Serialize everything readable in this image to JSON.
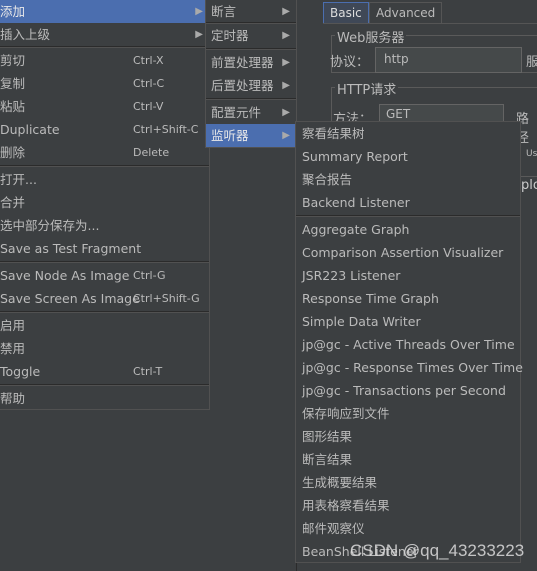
{
  "background": {
    "tabs": [
      "Basic",
      "Advanced"
    ],
    "web_server_group": "Web服务器",
    "protocol_label": "协议：",
    "protocol_value": "http",
    "server_label_partial": "服",
    "http_request_group": "HTTP请求",
    "method_label": "方法：",
    "method_value": "GET",
    "path_label_partial": "路径",
    "use_partial": "Us",
    "plo_partial": "plo"
  },
  "main_menu": {
    "items": [
      {
        "label": "添加",
        "submenu": true,
        "selected": true
      },
      {
        "label": "插入上级",
        "submenu": true
      },
      {
        "label": "剪切",
        "shortcut": "Ctrl-X"
      },
      {
        "label": "复制",
        "shortcut": "Ctrl-C"
      },
      {
        "label": "粘贴",
        "shortcut": "Ctrl-V"
      },
      {
        "label": "Duplicate",
        "shortcut": "Ctrl+Shift-C"
      },
      {
        "label": "删除",
        "shortcut": "Delete"
      },
      {
        "label": "打开..."
      },
      {
        "label": "合并"
      },
      {
        "label": "选中部分保存为..."
      },
      {
        "label": "Save as Test Fragment"
      },
      {
        "label": "Save Node As Image",
        "shortcut": "Ctrl-G"
      },
      {
        "label": "Save Screen As Image",
        "shortcut": "Ctrl+Shift-G"
      },
      {
        "label": "启用"
      },
      {
        "label": "禁用"
      },
      {
        "label": "Toggle",
        "shortcut": "Ctrl-T"
      },
      {
        "label": "帮助"
      }
    ]
  },
  "add_submenu": {
    "items": [
      "断言",
      "定时器",
      "前置处理器",
      "后置处理器",
      "配置元件",
      "监听器"
    ],
    "selected": "监听器"
  },
  "listener_submenu": {
    "items": [
      "察看结果树",
      "Summary Report",
      "聚合报告",
      "Backend Listener",
      "Aggregate Graph",
      "Comparison Assertion Visualizer",
      "JSR223 Listener",
      "Response Time Graph",
      "Simple Data Writer",
      "jp@gc - Active Threads Over Time",
      "jp@gc - Response Times Over Time",
      "jp@gc - Transactions per Second",
      "保存响应到文件",
      "图形结果",
      "断言结果",
      "生成概要结果",
      "用表格察看结果",
      "邮件观察仪",
      "BeanShell Listener"
    ]
  },
  "watermark": "CSDN @qq_43233223",
  "colors": {
    "background": "#3c3f41",
    "selection": "#4b6eaf",
    "text": "#bbbbbb"
  }
}
